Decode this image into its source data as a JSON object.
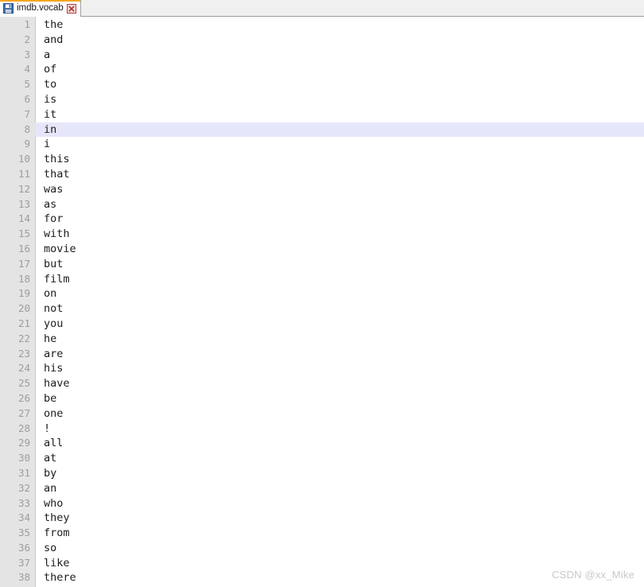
{
  "tabbar": {
    "tabs": [
      {
        "label": "imdb.vocab",
        "icon": "file-save-icon",
        "close_icon": "close-icon",
        "active": true
      }
    ]
  },
  "editor": {
    "active_line": 8,
    "colors": {
      "gutter_bg": "#e4e4e4",
      "gutter_border": "#c8c8c8",
      "line_number": "#9d9d9d",
      "text": "#1c1c1c",
      "active_line_bg": "#e6e6fa",
      "tab_accent": "#f5a623",
      "tab_close": "#c0504d",
      "watermark": "#c9c9c9"
    },
    "lines": [
      {
        "no": "1",
        "text": "the"
      },
      {
        "no": "2",
        "text": "and"
      },
      {
        "no": "3",
        "text": "a"
      },
      {
        "no": "4",
        "text": "of"
      },
      {
        "no": "5",
        "text": "to"
      },
      {
        "no": "6",
        "text": "is"
      },
      {
        "no": "7",
        "text": "it"
      },
      {
        "no": "8",
        "text": "in"
      },
      {
        "no": "9",
        "text": "i"
      },
      {
        "no": "10",
        "text": "this"
      },
      {
        "no": "11",
        "text": "that"
      },
      {
        "no": "12",
        "text": "was"
      },
      {
        "no": "13",
        "text": "as"
      },
      {
        "no": "14",
        "text": "for"
      },
      {
        "no": "15",
        "text": "with"
      },
      {
        "no": "16",
        "text": "movie"
      },
      {
        "no": "17",
        "text": "but"
      },
      {
        "no": "18",
        "text": "film"
      },
      {
        "no": "19",
        "text": "on"
      },
      {
        "no": "20",
        "text": "not"
      },
      {
        "no": "21",
        "text": "you"
      },
      {
        "no": "22",
        "text": "he"
      },
      {
        "no": "23",
        "text": "are"
      },
      {
        "no": "24",
        "text": "his"
      },
      {
        "no": "25",
        "text": "have"
      },
      {
        "no": "26",
        "text": "be"
      },
      {
        "no": "27",
        "text": "one"
      },
      {
        "no": "28",
        "text": "!"
      },
      {
        "no": "29",
        "text": "all"
      },
      {
        "no": "30",
        "text": "at"
      },
      {
        "no": "31",
        "text": "by"
      },
      {
        "no": "32",
        "text": "an"
      },
      {
        "no": "33",
        "text": "who"
      },
      {
        "no": "34",
        "text": "they"
      },
      {
        "no": "35",
        "text": "from"
      },
      {
        "no": "36",
        "text": "so"
      },
      {
        "no": "37",
        "text": "like"
      },
      {
        "no": "38",
        "text": "there"
      }
    ]
  },
  "watermark": {
    "text": "CSDN @xx_Mike"
  }
}
